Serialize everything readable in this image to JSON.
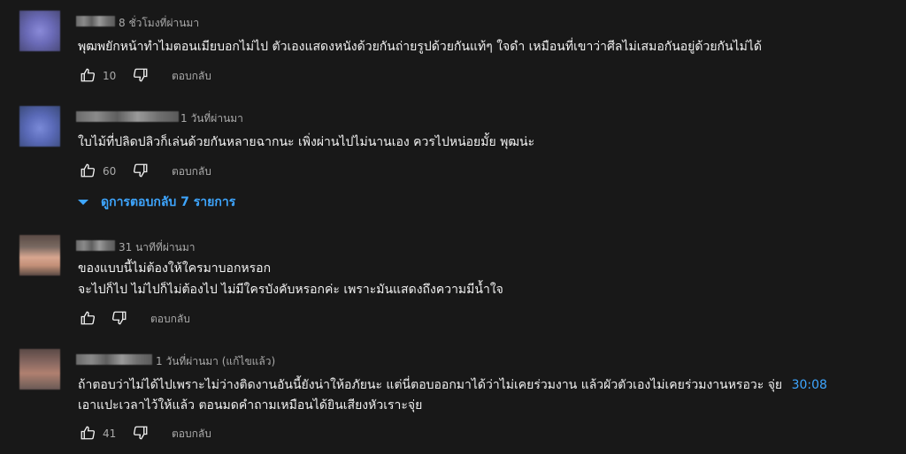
{
  "comments": [
    {
      "time": "8 ชั่วโมงที่ผ่านมา",
      "text_lines": [
        "พุฒพยักหน้าทำไมตอนเมียบอกไม่ไป ตัวเองแสดงหนังด้วยกันถ่ายรูปด้วยกันแท้ๆ ใจดำ เหมือนที่เขาว่าศีลไม่เสมอกันอยู่ด้วยกันไม่ได้"
      ],
      "likes": "10",
      "reply_label": "ตอบกลับ"
    },
    {
      "time": "1 วันที่ผ่านมา",
      "text_lines": [
        "ใบไม้ที่ปลิดปลิวก็เล่นด้วยกันหลายฉากนะ เพิ่งผ่านไปไม่นานเอง ควรไปหน่อยมั้ย พุฒน่ะ"
      ],
      "likes": "60",
      "reply_label": "ตอบกลับ",
      "view_replies": "ดูการตอบกลับ 7 รายการ"
    },
    {
      "time": "31 นาทีที่ผ่านมา",
      "text_lines": [
        "ของแบบนี้ไม่ต้องให้ใครมาบอกหรอก",
        "จะไปก็ไป ไม่ไปก็ไม่ต้องไป ไม่มีใครบังคับหรอกค่ะ เพราะมันแสดงถึงความมีน้ำใจ"
      ],
      "likes": "",
      "reply_label": "ตอบกลับ"
    },
    {
      "time": "1 วันที่ผ่านมา (แก้ไขแล้ว)",
      "text_line1": "ถ้าตอบว่าไม่ได้ไปเพราะไม่ว่างติดงานอันนี้ยังน่าให้อภัยนะ แต่นี่ตอบออกมาได้ว่าไม่เคยร่วมงาน แล้วผัวตัวเองไม่เคยร่วมงานหรอวะ จุ่ย",
      "timestamp_link": "30:08",
      "text_line2": "เอาแปะเวลาไว้ให้แล้ว ตอนมดคำถามเหมือนได้ยินเสียงหัวเราะจุ่ย",
      "likes": "41",
      "reply_label": "ตอบกลับ"
    }
  ],
  "icons": {
    "like": "thumb-up-icon",
    "dislike": "thumb-down-icon",
    "expand": "caret-down-icon"
  },
  "colors": {
    "background": "#181818",
    "text": "#f1f1f1",
    "secondary": "#aaaaaa",
    "link": "#3ea6ff"
  }
}
